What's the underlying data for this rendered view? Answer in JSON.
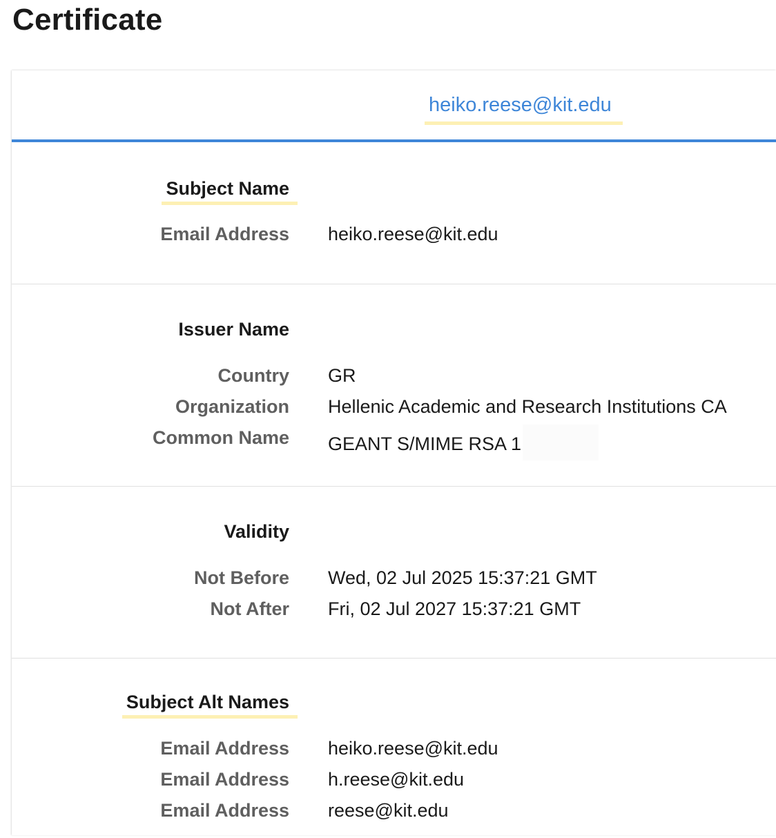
{
  "page": {
    "title": "Certificate"
  },
  "tabs": [
    {
      "label": "heiko.reese@kit.edu",
      "selected": true
    }
  ],
  "accent_color": "#3e86d8",
  "highlight_color": "#fdf0b4",
  "sections": {
    "subject": {
      "title": "Subject Name",
      "rows": [
        {
          "label": "Email Address",
          "value": "heiko.reese@kit.edu"
        }
      ]
    },
    "issuer": {
      "title": "Issuer Name",
      "rows": [
        {
          "label": "Country",
          "value": "GR"
        },
        {
          "label": "Organization",
          "value": "Hellenic Academic and Research Institutions CA"
        },
        {
          "label": "Common Name",
          "value": "GEANT S/MIME RSA 1"
        }
      ]
    },
    "validity": {
      "title": "Validity",
      "rows": [
        {
          "label": "Not Before",
          "value": "Wed, 02 Jul 2025 15:37:21 GMT"
        },
        {
          "label": "Not After",
          "value": "Fri, 02 Jul 2027 15:37:21 GMT"
        }
      ]
    },
    "san": {
      "title": "Subject Alt Names",
      "rows": [
        {
          "label": "Email Address",
          "value": "heiko.reese@kit.edu"
        },
        {
          "label": "Email Address",
          "value": "h.reese@kit.edu"
        },
        {
          "label": "Email Address",
          "value": "reese@kit.edu"
        }
      ]
    }
  }
}
